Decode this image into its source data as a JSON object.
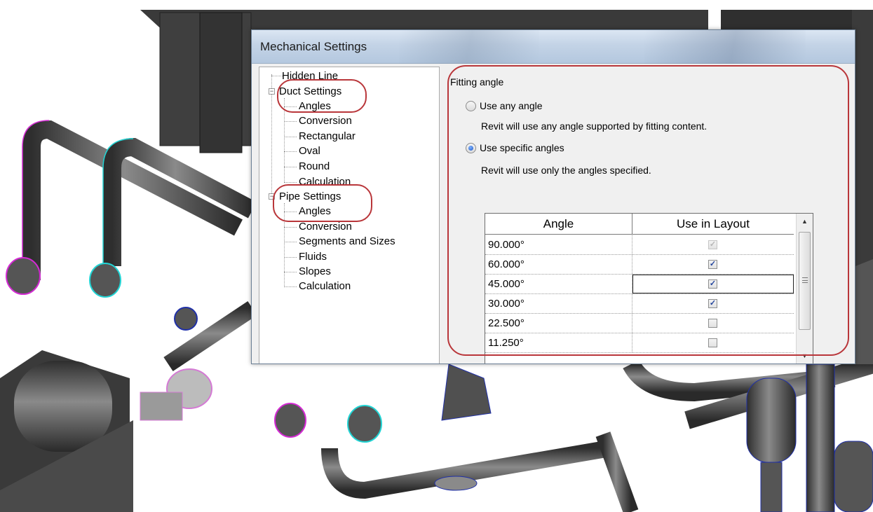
{
  "dialog": {
    "title": "Mechanical Settings",
    "tree": [
      {
        "label": "Hidden Line",
        "level": 0
      },
      {
        "label": "Duct Settings",
        "level": 0,
        "expanded": true
      },
      {
        "label": "Angles",
        "level": 1
      },
      {
        "label": "Conversion",
        "level": 1
      },
      {
        "label": "Rectangular",
        "level": 1
      },
      {
        "label": "Oval",
        "level": 1
      },
      {
        "label": "Round",
        "level": 1
      },
      {
        "label": "Calculation",
        "level": 1
      },
      {
        "label": "Pipe Settings",
        "level": 0,
        "expanded": true
      },
      {
        "label": "Angles",
        "level": 1,
        "selected": true
      },
      {
        "label": "Conversion",
        "level": 1
      },
      {
        "label": "Segments and Sizes",
        "level": 1
      },
      {
        "label": "Fluids",
        "level": 1
      },
      {
        "label": "Slopes",
        "level": 1
      },
      {
        "label": "Calculation",
        "level": 1
      }
    ],
    "fitting_angle": {
      "section_title": "Fitting angle",
      "option_any": {
        "label": "Use any angle",
        "description": "Revit will use any angle supported by fitting content.",
        "selected": false
      },
      "option_specific": {
        "label": "Use specific angles",
        "description": "Revit will use only the angles specified.",
        "selected": true
      },
      "table": {
        "columns": [
          "Angle",
          "Use in Layout"
        ],
        "rows": [
          {
            "angle": "90.000°",
            "use": true,
            "enabled": false
          },
          {
            "angle": "60.000°",
            "use": true,
            "enabled": true
          },
          {
            "angle": "45.000°",
            "use": true,
            "enabled": true,
            "selected": true
          },
          {
            "angle": "30.000°",
            "use": true,
            "enabled": true
          },
          {
            "angle": "22.500°",
            "use": false,
            "enabled": true
          },
          {
            "angle": "11.250°",
            "use": false,
            "enabled": true
          }
        ]
      }
    }
  },
  "colors": {
    "callout": "#b9363a",
    "pipe": "#4a4a4a",
    "edge_cyan": "#22d4d4",
    "edge_magenta": "#d42ad4",
    "edge_blue": "#2030a8"
  }
}
